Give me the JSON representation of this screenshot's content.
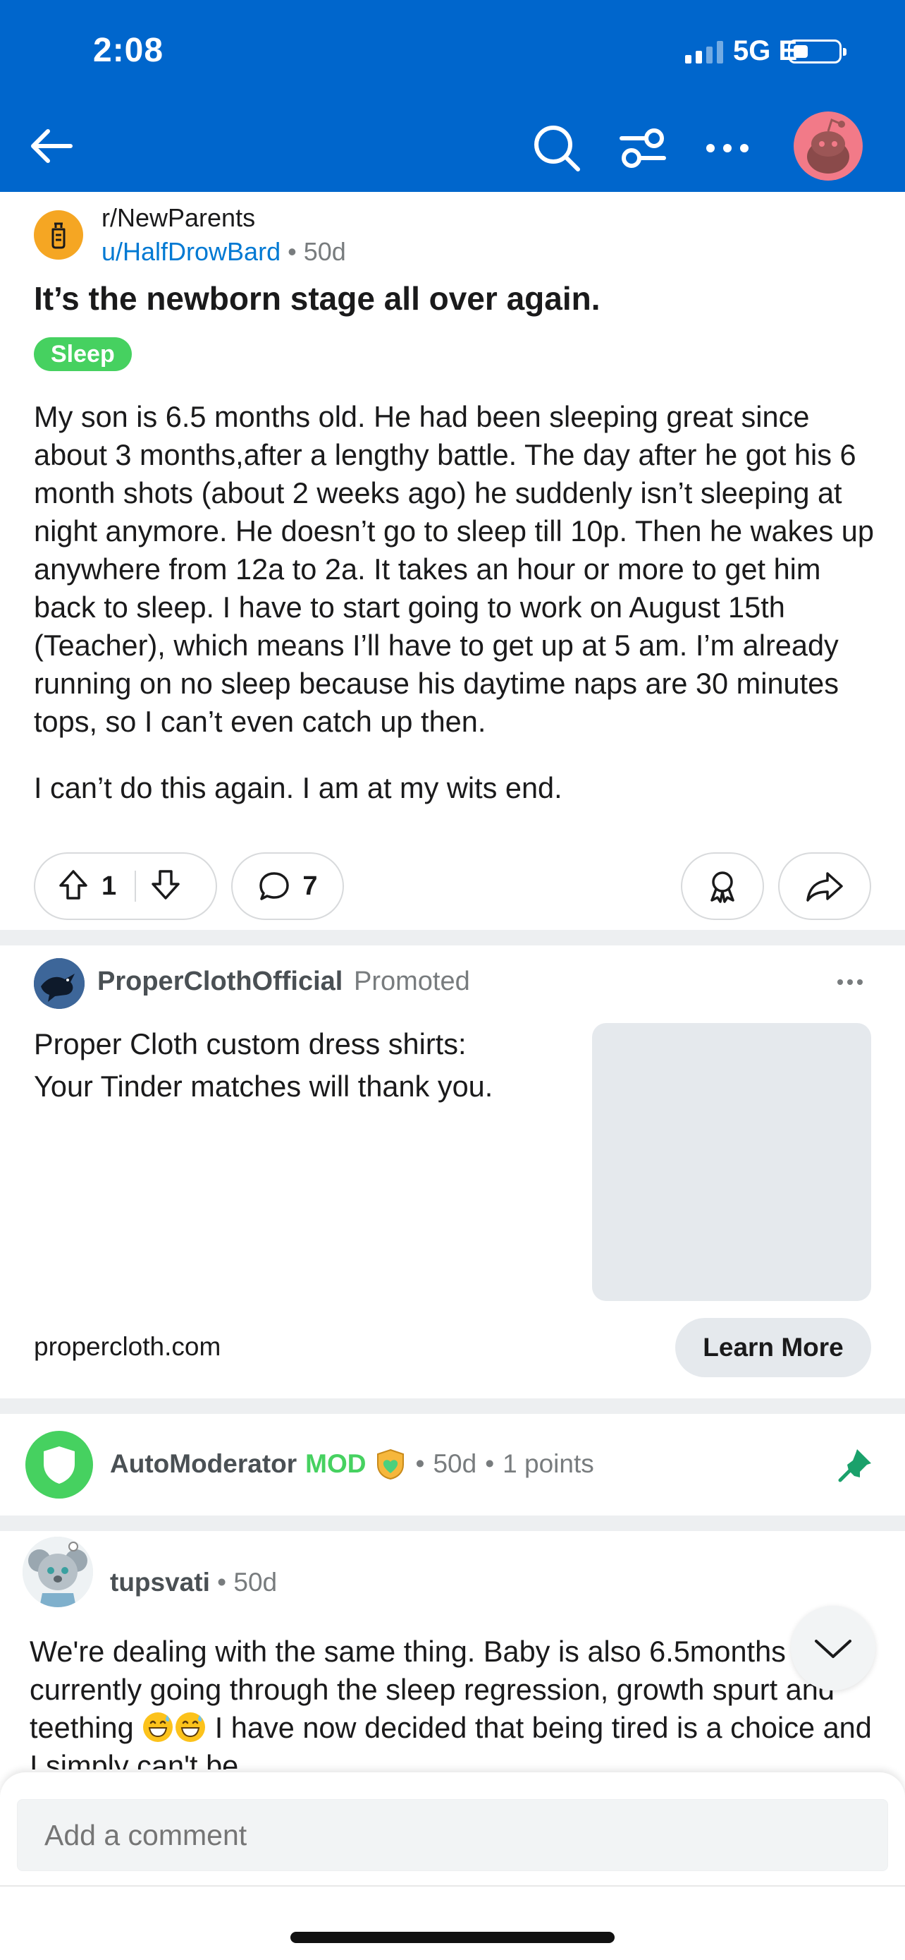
{
  "status_bar": {
    "time": "2:08",
    "network": "5G E"
  },
  "post": {
    "subreddit": "r/NewParents",
    "author": "u/HalfDrowBard",
    "age": "50d",
    "dot": "•",
    "title": "It’s the newborn stage all over again.",
    "flair": "Sleep",
    "body": [
      "My son is 6.5 months old. He had been sleeping great since about 3 months,after a lengthy battle. The day after he got his 6 month shots (about 2 weeks ago) he suddenly isn’t sleeping at night anymore. He doesn’t go to sleep till 10p. Then he wakes up anywhere from 12a to 2a. It takes an hour or more to get him back to sleep. I have to start going to work on August 15th (Teacher), which means I’ll have to get up at 5 am. I’m already running on no sleep because his daytime naps are 30 minutes tops, so I can’t even catch up then.",
      "I can’t do this again. I am at my wits end."
    ],
    "upvotes": "1",
    "comments": "7"
  },
  "ad": {
    "author": "ProperClothOfficial",
    "promoted": "Promoted",
    "text_line1": "Proper Cloth custom dress shirts:",
    "text_line2": "Your Tinder matches will thank you.",
    "domain": "propercloth.com",
    "cta": "Learn More"
  },
  "automod": {
    "name": "AutoModerator",
    "tag": "MOD",
    "age": "50d",
    "points": "1 points",
    "dot": "•"
  },
  "comment": {
    "author": "tupsvati",
    "age": "50d",
    "dot": "•",
    "text_a": "We're dealing with the same thing. Baby is also 6.5months and is currently going through the sleep regression, growth spurt and teething ",
    "text_b": " I have now decided that being tired is a choice and I simply can't be"
  },
  "composer": {
    "placeholder": "Add a comment"
  },
  "colors": {
    "header_blue": "#0066cc",
    "flair_green": "#46d160",
    "link_blue": "#0079d3",
    "avatar_pink": "#f27a88",
    "subreddit_icon": "#f5a623"
  }
}
